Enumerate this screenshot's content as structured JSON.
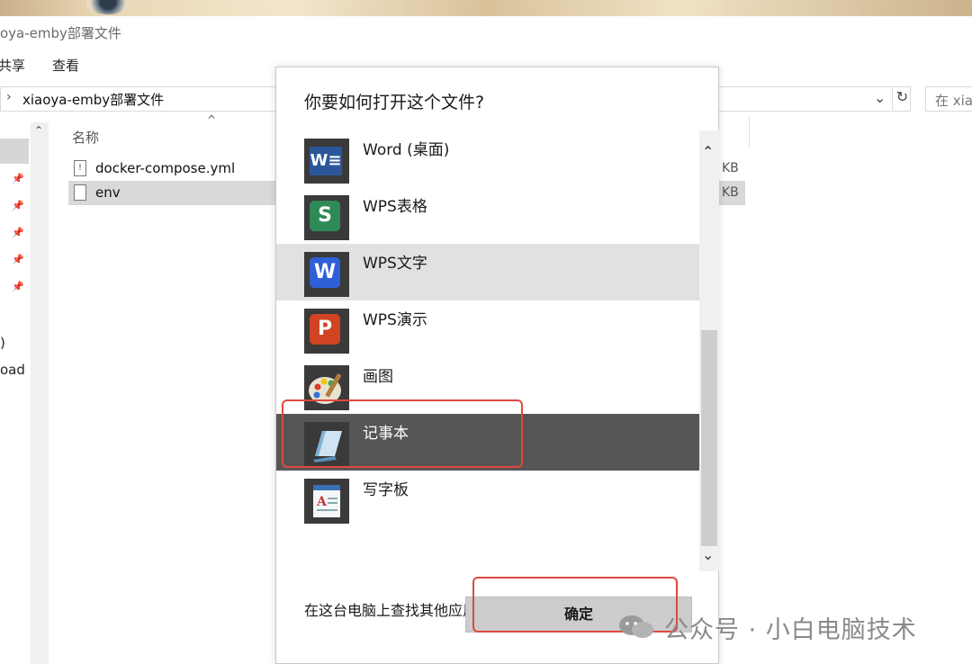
{
  "explorer": {
    "title": "oya-emby部署文件",
    "ribbon": {
      "share": "共享",
      "view": "查看"
    },
    "address": "xiaoya-emby部署文件",
    "search_placeholder": "在 xia",
    "column_name": "名称",
    "nav_items": [
      ")",
      "oad"
    ],
    "files": [
      {
        "name": "docker-compose.yml",
        "size_unit": "KB"
      },
      {
        "name": "env",
        "size_unit": "KB"
      }
    ]
  },
  "dialog": {
    "title": "你要如何打开这个文件?",
    "apps": [
      {
        "label": "Word (桌面)",
        "icon": "word-icon",
        "color": "#2b579a",
        "glyph": "W"
      },
      {
        "label": "WPS表格",
        "icon": "wps-sheets-icon",
        "color": "#2e8b57",
        "glyph": "S"
      },
      {
        "label": "WPS文字",
        "icon": "wps-writer-icon",
        "color": "#2f5fd6",
        "glyph": "W"
      },
      {
        "label": "WPS演示",
        "icon": "wps-presentation-icon",
        "color": "#d04423",
        "glyph": "P"
      },
      {
        "label": "画图",
        "icon": "paint-icon",
        "color": "#4a7fb5",
        "glyph": ""
      },
      {
        "label": "记事本",
        "icon": "notepad-icon",
        "color": "#7fb3d5",
        "glyph": ""
      },
      {
        "label": "写字板",
        "icon": "wordpad-icon",
        "color": "#3b6fb6",
        "glyph": ""
      }
    ],
    "find_more": "在这台电脑上查找其他应用",
    "ok_label": "确定",
    "hover_index": 2,
    "selected_index": 5
  },
  "watermark": {
    "text": "公众号 · 小白电脑技术"
  },
  "colors": {
    "highlight": "#e0483e",
    "selected_row": "#565656",
    "hover_row": "#e1e1e1"
  }
}
